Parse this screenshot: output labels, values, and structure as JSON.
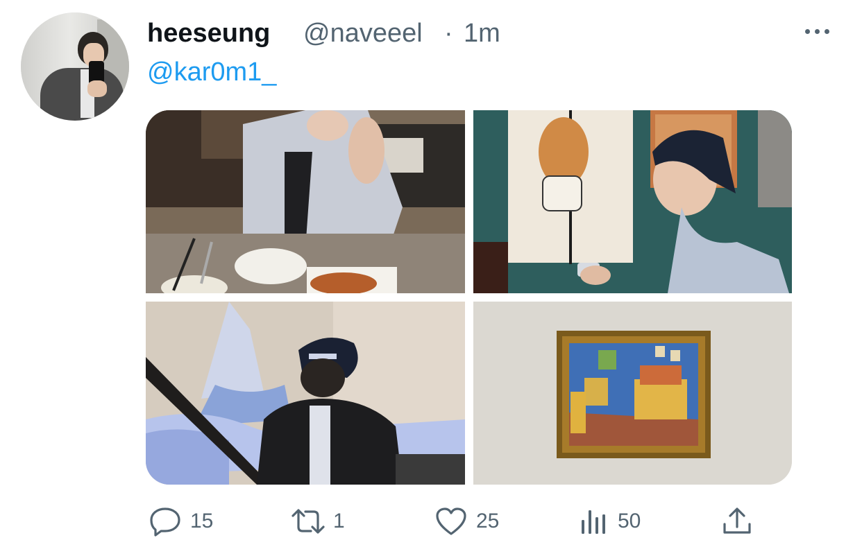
{
  "tweet": {
    "display_name": "heeseung",
    "handle": "@naveeel",
    "separator": "·",
    "time": "1m",
    "reply_to": "@kar0m1_",
    "photos": [
      {
        "alt": "photo-restaurant"
      },
      {
        "alt": "photo-cafe-curtain"
      },
      {
        "alt": "photo-cap-stairs"
      },
      {
        "alt": "photo-painting"
      }
    ]
  },
  "actions": {
    "replies": "15",
    "retweets": "1",
    "likes": "25",
    "views": "50"
  },
  "colors": {
    "text": "#0f1419",
    "secondary": "#536471",
    "link": "#1d9bf0"
  },
  "icons": [
    "more-horizontal-icon",
    "reply-icon",
    "retweet-icon",
    "like-icon",
    "views-icon",
    "share-icon"
  ]
}
